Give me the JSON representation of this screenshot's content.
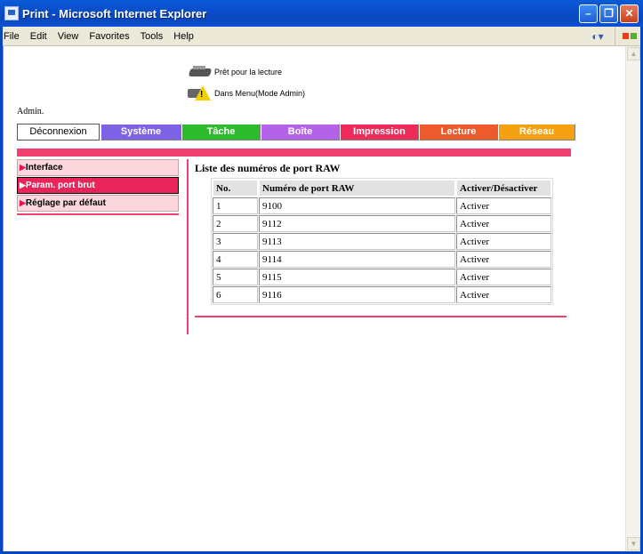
{
  "window": {
    "title": "Print - Microsoft Internet Explorer"
  },
  "menu": [
    "File",
    "Edit",
    "View",
    "Favorites",
    "Tools",
    "Help"
  ],
  "status": {
    "ready": "Prêt pour la lecture",
    "mode": "Dans Menu(Mode Admin)"
  },
  "user": "Admin.",
  "tabs": {
    "logout": "Déconnexion",
    "items": [
      "Système",
      "Tâche",
      "Boîte",
      "Impression",
      "Lecture",
      "Réseau"
    ],
    "colors": [
      "#7e62e6",
      "#2bbb2c",
      "#b462e8",
      "#ee2b5a",
      "#ee5a2b",
      "#f5a011"
    ]
  },
  "sidebar": {
    "items": [
      {
        "label": "Interface",
        "active": false
      },
      {
        "label": "Param. port brut",
        "active": true
      },
      {
        "label": "Réglage par défaut",
        "active": false
      }
    ]
  },
  "main": {
    "title": "Liste des numéros de port RAW",
    "columns": [
      "No.",
      "Numéro de port RAW",
      "Activer/Désactiver"
    ],
    "rows": [
      [
        "1",
        "9100",
        "Activer"
      ],
      [
        "2",
        "9112",
        "Activer"
      ],
      [
        "3",
        "9113",
        "Activer"
      ],
      [
        "4",
        "9114",
        "Activer"
      ],
      [
        "5",
        "9115",
        "Activer"
      ],
      [
        "6",
        "9116",
        "Activer"
      ]
    ]
  },
  "accent_color": "#f04070"
}
